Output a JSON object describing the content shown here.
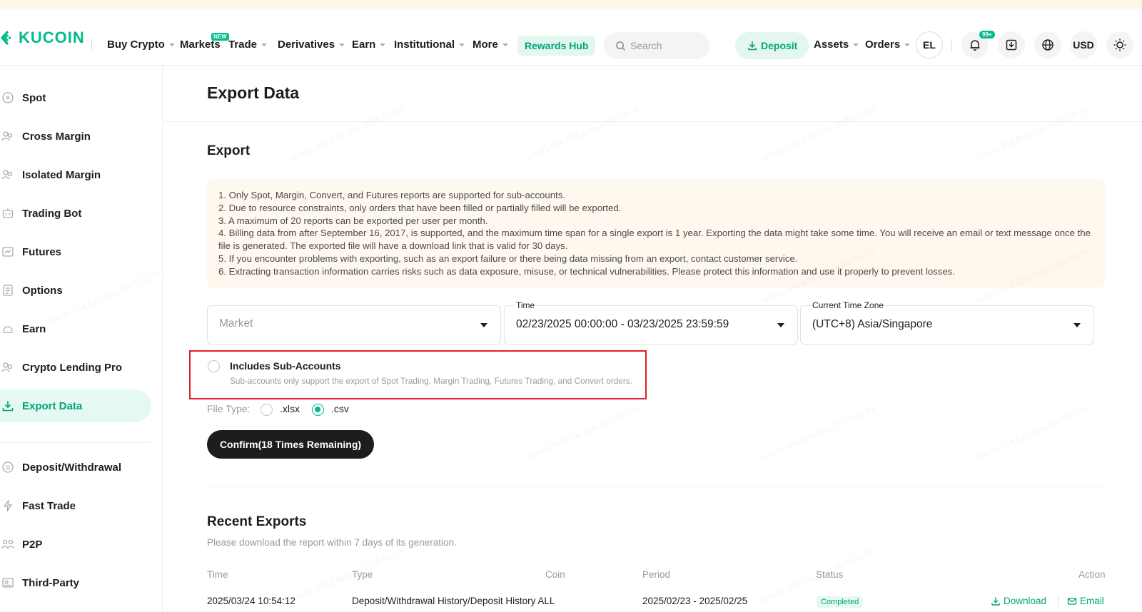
{
  "header": {
    "logo_text": "KUCOIN",
    "nav": [
      {
        "label": "Buy Crypto",
        "has_caret": true
      },
      {
        "label": "Markets",
        "has_caret": false,
        "badge": "NEW"
      },
      {
        "label": "Trade",
        "has_caret": true
      },
      {
        "label": "Derivatives",
        "has_caret": true
      },
      {
        "label": "Earn",
        "has_caret": true
      },
      {
        "label": "Institutional",
        "has_caret": true
      },
      {
        "label": "More",
        "has_caret": true
      }
    ],
    "markets_badge": "NEW",
    "rewards_hub": "Rewards Hub",
    "search_placeholder": "Search",
    "deposit": "Deposit",
    "assets": "Assets",
    "orders": "Orders",
    "avatar": "EL",
    "notif_badge": "99+",
    "currency": "USD"
  },
  "sidebar": {
    "items": [
      {
        "label": "Spot",
        "icon": "spot-icon"
      },
      {
        "label": "Cross Margin",
        "icon": "cross-margin-icon"
      },
      {
        "label": "Isolated Margin",
        "icon": "isolated-margin-icon"
      },
      {
        "label": "Trading Bot",
        "icon": "bot-icon"
      },
      {
        "label": "Futures",
        "icon": "futures-icon"
      },
      {
        "label": "Options",
        "icon": "options-icon"
      },
      {
        "label": "Earn",
        "icon": "earn-icon"
      },
      {
        "label": "Crypto Lending Pro",
        "icon": "lending-icon"
      },
      {
        "label": "Export Data",
        "icon": "export-icon",
        "active": true
      },
      {
        "label": "Deposit/Withdrawal",
        "icon": "deposit-withdrawal-icon"
      },
      {
        "label": "Fast Trade",
        "icon": "fast-trade-icon"
      },
      {
        "label": "P2P",
        "icon": "p2p-icon"
      },
      {
        "label": "Third-Party",
        "icon": "third-party-icon"
      }
    ]
  },
  "main": {
    "page_title": "Export Data",
    "section_title": "Export",
    "notices": [
      "1. Only Spot, Margin, Convert, and Futures reports are supported for sub-accounts.",
      "2. Due to resource constraints, only orders that have been filled or partially filled will be exported.",
      "3. A maximum of 20 reports can be exported per user per month.",
      "4. Billing data from after September 16, 2017, is supported, and the maximum time span for a single export is 1 year. Exporting the data might take some time. You will receive an email or text message once the file is generated. The exported file will have a download link that is valid for 30 days.",
      "5. If you encounter problems with exporting, such as an export failure or there being data missing from an export, contact customer service.",
      "6. Extracting transaction information carries risks such as data exposure, misuse, or technical vulnerabilities. Please protect this information and use it properly to prevent losses."
    ],
    "market": {
      "placeholder": "Market"
    },
    "time": {
      "label": "Time",
      "value": "02/23/2025 00:00:00 - 03/23/2025 23:59:59"
    },
    "timezone": {
      "label": "Current Time Zone",
      "value": "(UTC+8) Asia/Singapore"
    },
    "sub_accounts": {
      "title": "Includes Sub-Accounts",
      "description": "Sub-accounts only support the export of Spot Trading, Margin Trading, Futures Trading, and Convert orders.",
      "checked": false
    },
    "file_type": {
      "label": "File Type:",
      "options": [
        ".xlsx",
        ".csv"
      ],
      "selected": ".csv"
    },
    "confirm": "Confirm(18 Times Remaining)",
    "recent": {
      "title": "Recent Exports",
      "subtitle": "Please download the report within 7 days of its generation.",
      "columns": [
        "Time",
        "Type",
        "Coin",
        "Period",
        "Status",
        "Action"
      ],
      "rows": [
        {
          "time": "2025/03/24 10:54:12",
          "type": "Deposit/Withdrawal History/Deposit History ALL",
          "coin": "",
          "period": "2025/02/23 - 2025/02/25",
          "status": "Completed",
          "actions": [
            "Download",
            "Email"
          ]
        }
      ]
    }
  },
  "watermark_text": "szlvd1-344,Ella.Guo,2025-03-24",
  "colors": {
    "accent": "#01bc8d",
    "accent_dark": "#01a57b",
    "notice_bg": "#fff8ee",
    "highlight_box": "#e0202a"
  }
}
